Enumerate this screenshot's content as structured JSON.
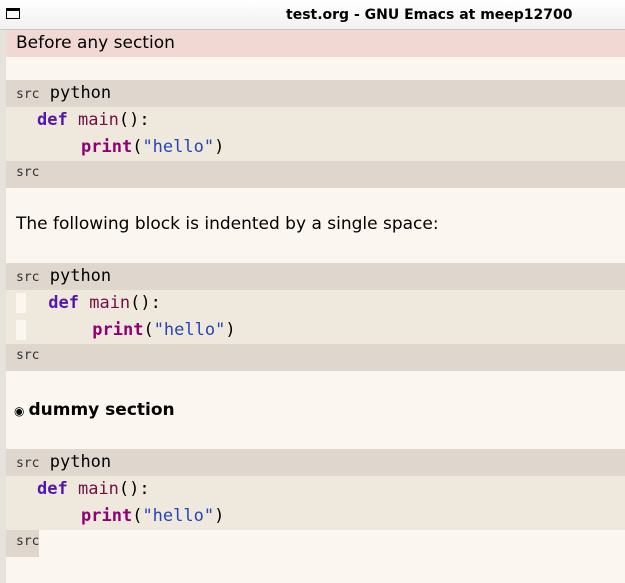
{
  "window": {
    "title": "test.org - GNU Emacs at meep12700"
  },
  "buffer": {
    "intro": "Before any section",
    "blocks": [
      {
        "begin": "src",
        "lang": "python",
        "end": "src",
        "line1_kw": "def",
        "line1_fn": "main",
        "line1_rest": "():",
        "line2_fn": "print",
        "line2_open": "(",
        "line2_str": "\"hello\"",
        "line2_close": ")"
      },
      {
        "begin": "src",
        "lang": "python",
        "end": "src",
        "line1_kw": "def",
        "line1_fn": "main",
        "line1_rest": "():",
        "line2_fn": "print",
        "line2_open": "(",
        "line2_str": "\"hello\"",
        "line2_close": ")"
      },
      {
        "begin": "src",
        "lang": "python",
        "end": "src",
        "line1_kw": "def",
        "line1_fn": "main",
        "line1_rest": "():",
        "line2_fn": "print",
        "line2_open": "(",
        "line2_str": "\"hello\"",
        "line2_close": ")"
      }
    ],
    "middle_text": "The following block is indented by a single space:",
    "section": {
      "bullet": "◉",
      "title": "dummy section"
    }
  }
}
